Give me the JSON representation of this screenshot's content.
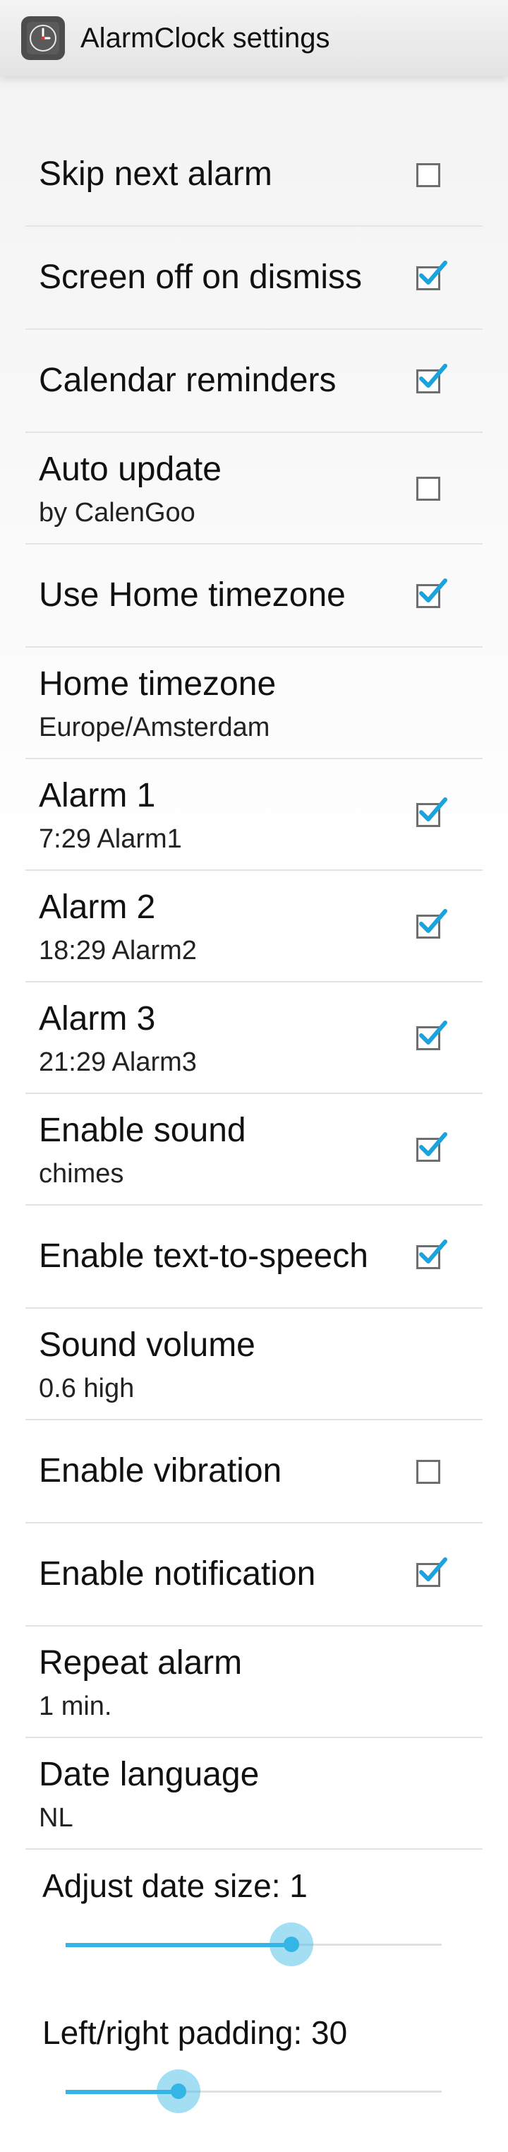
{
  "app": {
    "title": "AlarmClock settings",
    "icon": "clock-icon"
  },
  "colors": {
    "accent": "#33b5e5",
    "check": "#1aa3dd"
  },
  "preferences": [
    {
      "title": "Skip next alarm",
      "summary": "",
      "checkbox": true,
      "checked": false
    },
    {
      "title": "Screen off on dismiss",
      "summary": "",
      "checkbox": true,
      "checked": true
    },
    {
      "title": "Calendar reminders",
      "summary": "",
      "checkbox": true,
      "checked": true
    },
    {
      "title": "Auto update",
      "summary": "by CalenGoo",
      "checkbox": true,
      "checked": false
    },
    {
      "title": "Use Home timezone",
      "summary": "",
      "checkbox": true,
      "checked": true
    },
    {
      "title": "Home timezone",
      "summary": "Europe/Amsterdam",
      "checkbox": false,
      "checked": false
    },
    {
      "title": "Alarm 1",
      "summary": "7:29  Alarm1",
      "checkbox": true,
      "checked": true
    },
    {
      "title": "Alarm 2",
      "summary": "18:29  Alarm2",
      "checkbox": true,
      "checked": true
    },
    {
      "title": "Alarm 3",
      "summary": "21:29  Alarm3",
      "checkbox": true,
      "checked": true
    },
    {
      "title": "Enable sound",
      "summary": "chimes",
      "checkbox": true,
      "checked": true
    },
    {
      "title": "Enable text-to-speech",
      "summary": "",
      "checkbox": true,
      "checked": true
    },
    {
      "title": "Sound volume",
      "summary": "0.6 high",
      "checkbox": false,
      "checked": false
    },
    {
      "title": "Enable vibration",
      "summary": "",
      "checkbox": true,
      "checked": false
    },
    {
      "title": "Enable notification",
      "summary": "",
      "checkbox": true,
      "checked": true
    },
    {
      "title": "Repeat alarm",
      "summary": "1 min.",
      "checkbox": false,
      "checked": false
    },
    {
      "title": "Date language",
      "summary": "NL",
      "checkbox": false,
      "checked": false
    }
  ],
  "sliders": [
    {
      "label": "Adjust date size: 1",
      "fraction": 0.6
    },
    {
      "label": "Left/right padding: 30",
      "fraction": 0.3
    }
  ]
}
